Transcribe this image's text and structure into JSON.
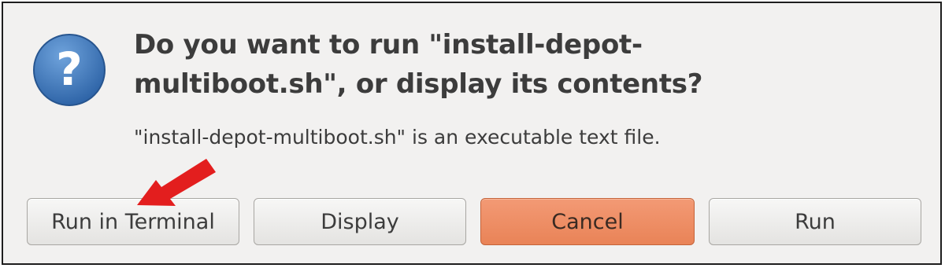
{
  "dialog": {
    "icon": "question-icon",
    "icon_glyph": "?",
    "title": "Do you want to run \"install-depot-multiboot.sh\", or display its contents?",
    "message": "\"install-depot-multiboot.sh\" is an executable text file."
  },
  "buttons": {
    "run_in_terminal": "Run in Terminal",
    "display": "Display",
    "cancel": "Cancel",
    "run": "Run"
  },
  "colors": {
    "accent_button": "#e98357",
    "icon_blue": "#3f78b9",
    "annotation_arrow": "#e31e1e"
  }
}
